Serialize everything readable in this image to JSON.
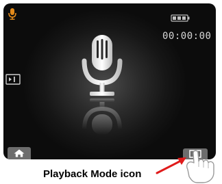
{
  "screen": {
    "timer": "00:00:00",
    "status_icon": "microphone-icon",
    "battery_icon": "battery-icon",
    "side_icon": "video-mode-icon",
    "main_icon": "microphone-icon"
  },
  "controls": {
    "home_icon": "home-icon",
    "playback_icon": "playback-mode-icon"
  },
  "annotation": {
    "caption": "Playback Mode icon",
    "arrow_icon": "arrow-icon",
    "hand_icon": "pointing-hand-icon"
  },
  "colors": {
    "accent": "#e28a1a",
    "screen_bg": "#111111",
    "button_bg": "#6d6d6d",
    "arrow": "#e01b1b"
  }
}
